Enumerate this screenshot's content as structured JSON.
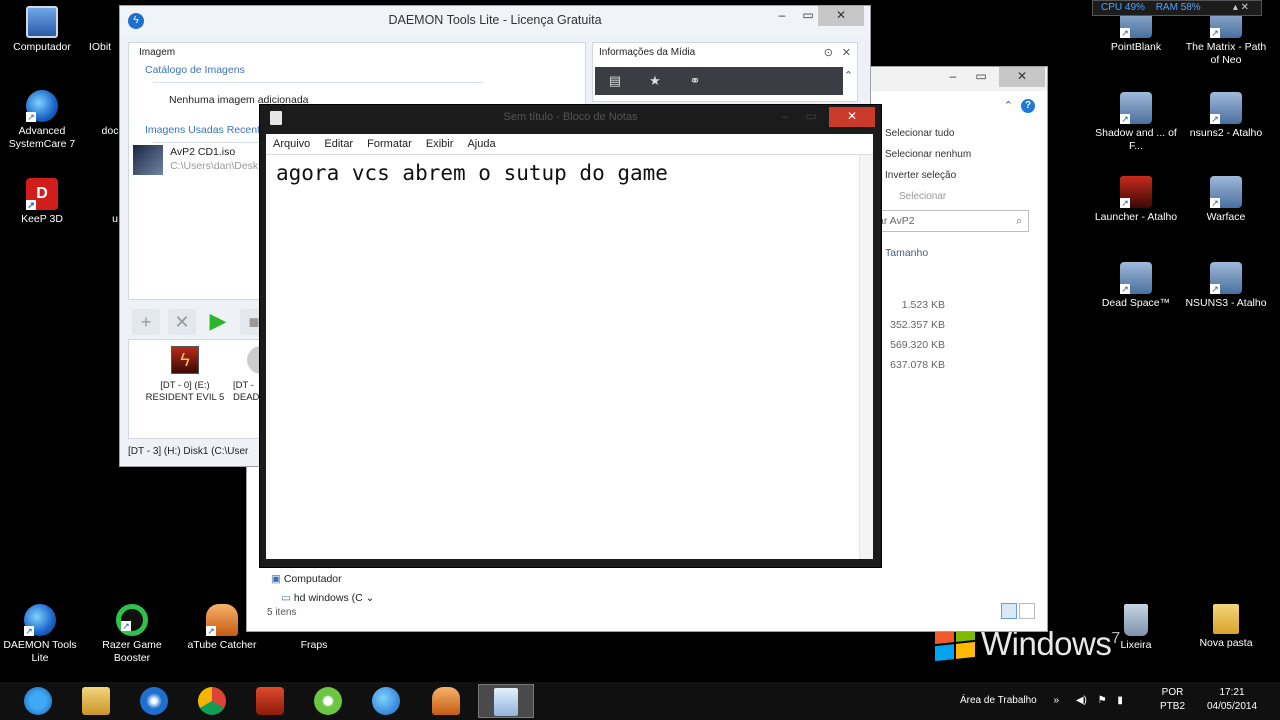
{
  "desktop": {
    "left_icons": [
      {
        "label": "Computador"
      },
      {
        "label": "IObit"
      },
      {
        "label": "Advanced SystemCare 7"
      },
      {
        "label": "doc"
      },
      {
        "label": "KeeP 3D"
      },
      {
        "label": "u"
      }
    ],
    "right_icons": [
      {
        "label": "PointBlank"
      },
      {
        "label": "The Matrix - Path of Neo"
      },
      {
        "label": "Shadow and ... of F..."
      },
      {
        "label": "nsuns2 - Atalho"
      },
      {
        "label": "Launcher - Atalho"
      },
      {
        "label": "Warface"
      },
      {
        "label": "Dead Space™"
      },
      {
        "label": "NSUNS3 - Atalho"
      }
    ],
    "bottom_icons": [
      {
        "label": "DAEMON Tools Lite"
      },
      {
        "label": "Razer Game Booster"
      },
      {
        "label": "aTube Catcher"
      },
      {
        "label": "Fraps"
      },
      {
        "label": "Lixeira"
      },
      {
        "label": "Nova pasta"
      }
    ],
    "watermark": "Windows",
    "watermark_version": "7",
    "sysmon": {
      "cpu": "CPU 49%",
      "ram": "RAM 58%"
    }
  },
  "daemon": {
    "title": "DAEMON Tools Lite - Licença Gratuita",
    "panel_title": "Imagem",
    "catalog_label": "Catálogo de Imagens",
    "empty_text": "Nenhuma imagem adicionada",
    "recent_label": "Imagens Usadas Recente",
    "recent_item": {
      "name": "AvP2 CD1.iso",
      "path": "C:\\Users\\dan\\Desk"
    },
    "media_info_title": "Informações da Mídia",
    "drives": [
      {
        "line1": "[DT - 0] (E:)",
        "line2": "RESIDENT EVIL 5"
      },
      {
        "line1": "[DT - ",
        "line2": "DEAD"
      }
    ],
    "status": "[DT - 3] (H:) Disk1 (C:\\User"
  },
  "explorer": {
    "ribbon": {
      "select_all": "Selecionar tudo",
      "select_none": "Selecionar nenhum",
      "invert": "Inverter seleção",
      "group": "Selecionar"
    },
    "search_placeholder": "ar AvP2",
    "column": "Tamanho",
    "sizes": [
      "1.523 KB",
      "352.357 KB",
      "569.320 KB",
      "637.078 KB"
    ],
    "nav": [
      "Computador",
      "hd windows (C"
    ],
    "status": "5 itens"
  },
  "notepad": {
    "title": "Sem título - Bloco de Notas",
    "menu": [
      "Arquivo",
      "Editar",
      "Formatar",
      "Exibir",
      "Ajuda"
    ],
    "text": "agora vcs abrem o sutup do game"
  },
  "taskbar": {
    "desktop_label": "Área de Trabalho",
    "lang": "POR",
    "lang_sub": "PTB2",
    "time": "17:21",
    "date": "04/05/2014"
  }
}
